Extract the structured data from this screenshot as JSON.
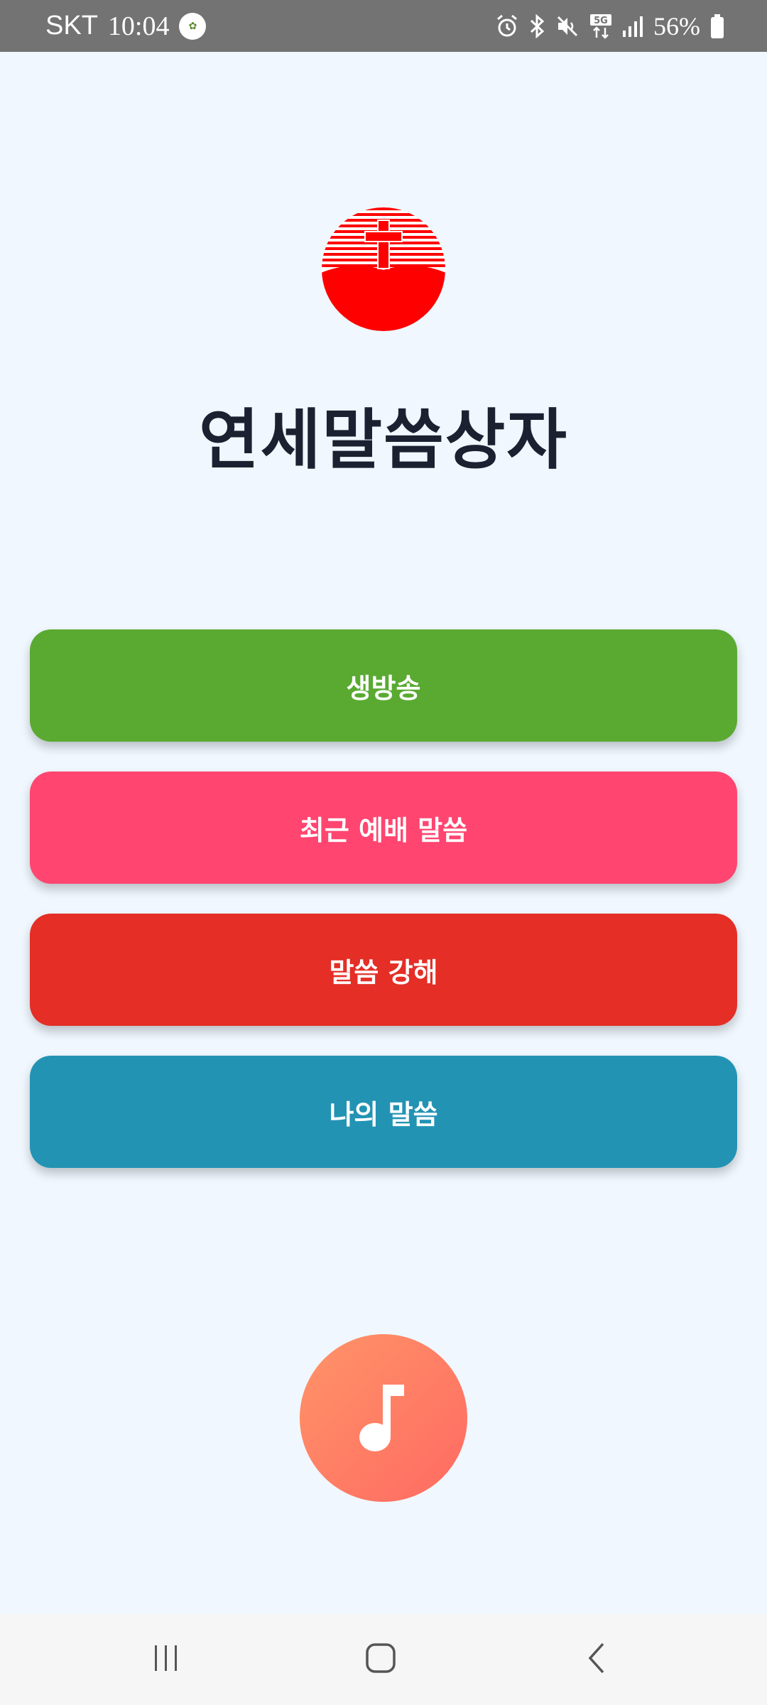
{
  "status_bar": {
    "carrier": "SKT",
    "time": "10:04",
    "battery": "56%",
    "network": "5G"
  },
  "app": {
    "title": "연세말씀상자"
  },
  "menu": {
    "live": "생방송",
    "recent_sermon": "최근 예배 말씀",
    "exposition": "말씀 강해",
    "my_word": "나의 말씀"
  },
  "colors": {
    "background": "#f0f7fe",
    "live": "#5aaa32",
    "recent_sermon": "#ff4570",
    "exposition": "#e42e26",
    "my_word": "#2393b4",
    "music_fab": "#ff7a64",
    "logo_red": "#ff0000"
  },
  "icons": {
    "music_fab": "music-note-icon",
    "logo": "cross-sunrise-logo",
    "nav_recent": "recent-apps-icon",
    "nav_home": "home-icon",
    "nav_back": "back-icon"
  }
}
